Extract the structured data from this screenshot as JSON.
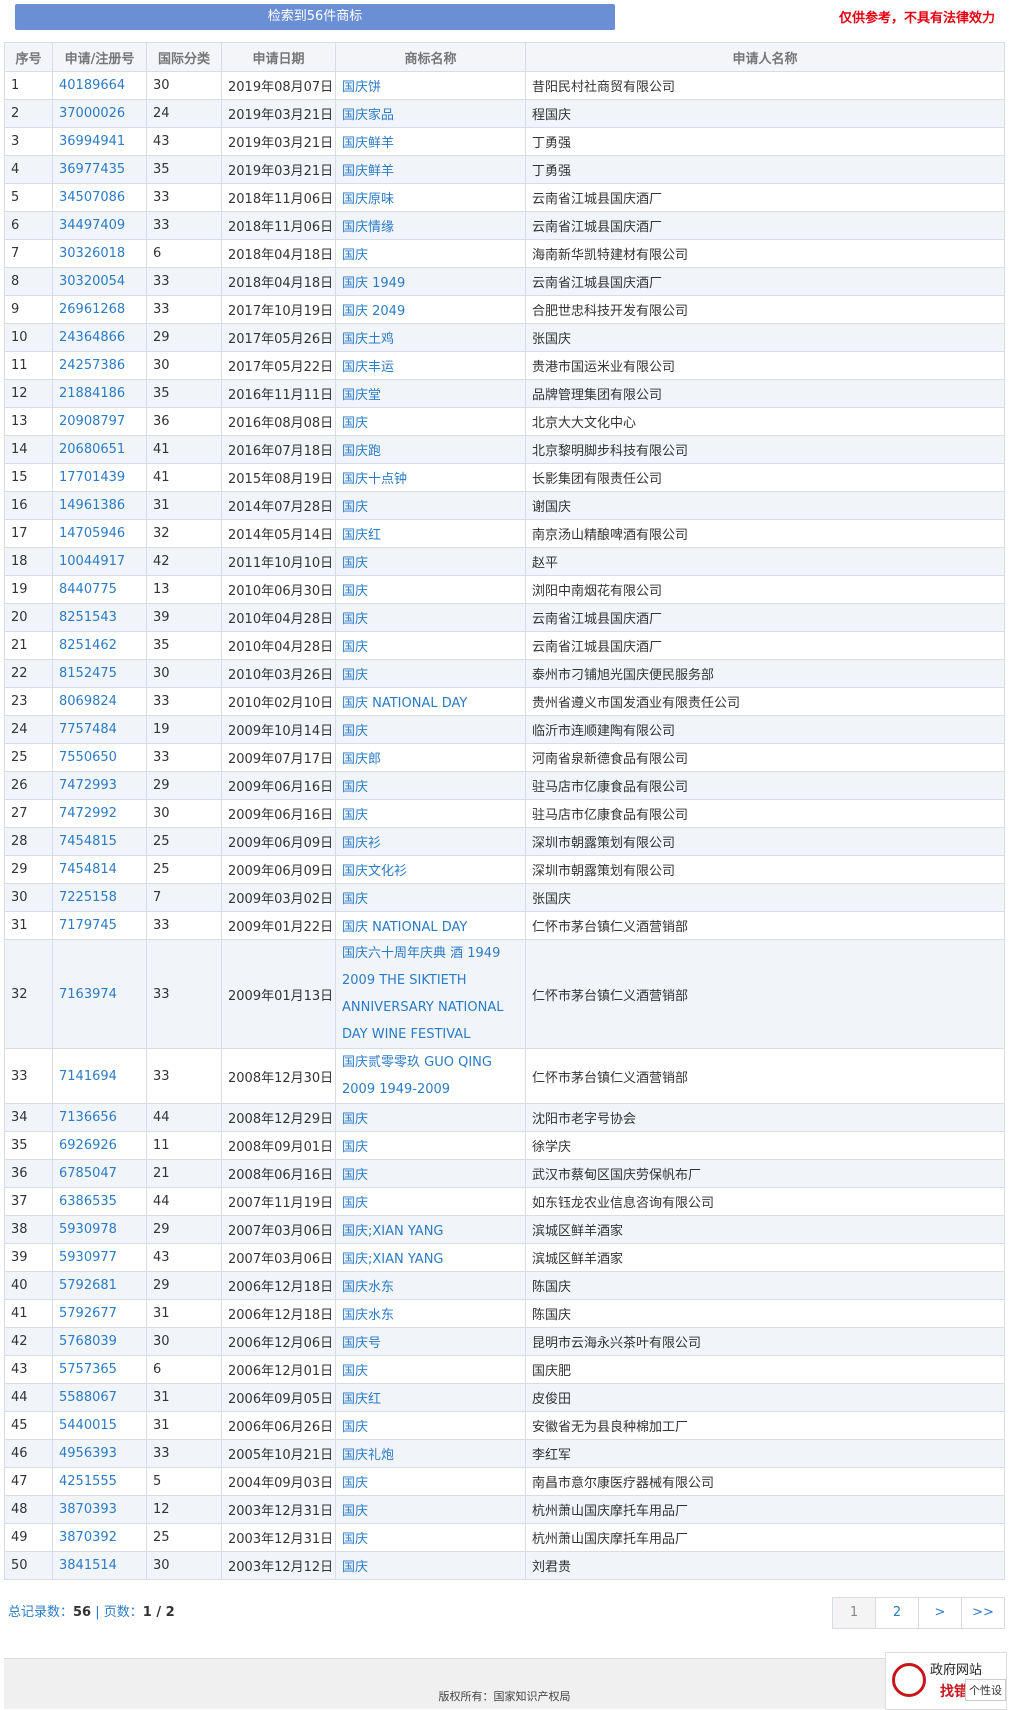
{
  "header": {
    "banner": "检索到56件商标",
    "disclaimer": "仅供参考，不具有法律效力"
  },
  "table": {
    "columns": [
      "序号",
      "申请/注册号",
      "国际分类",
      "申请日期",
      "商标名称",
      "申请人名称"
    ],
    "rows": [
      [
        "1",
        "40189664",
        "30",
        "2019年08月07日",
        "国庆饼",
        "昔阳民村社商贸有限公司"
      ],
      [
        "2",
        "37000026",
        "24",
        "2019年03月21日",
        "国庆家品",
        "程国庆"
      ],
      [
        "3",
        "36994941",
        "43",
        "2019年03月21日",
        "国庆鲜羊",
        "丁勇强"
      ],
      [
        "4",
        "36977435",
        "35",
        "2019年03月21日",
        "国庆鲜羊",
        "丁勇强"
      ],
      [
        "5",
        "34507086",
        "33",
        "2018年11月06日",
        "国庆原味",
        "云南省江城县国庆酒厂"
      ],
      [
        "6",
        "34497409",
        "33",
        "2018年11月06日",
        "国庆情缘",
        "云南省江城县国庆酒厂"
      ],
      [
        "7",
        "30326018",
        "6",
        "2018年04月18日",
        "国庆",
        "海南新华凯特建材有限公司"
      ],
      [
        "8",
        "30320054",
        "33",
        "2018年04月18日",
        "国庆 1949",
        "云南省江城县国庆酒厂"
      ],
      [
        "9",
        "26961268",
        "33",
        "2017年10月19日",
        "国庆 2049",
        "合肥世忠科技开发有限公司"
      ],
      [
        "10",
        "24364866",
        "29",
        "2017年05月26日",
        "国庆土鸡",
        "张国庆"
      ],
      [
        "11",
        "24257386",
        "30",
        "2017年05月22日",
        "国庆丰运",
        "贵港市国运米业有限公司"
      ],
      [
        "12",
        "21884186",
        "35",
        "2016年11月11日",
        "国庆堂",
        "品牌管理集团有限公司"
      ],
      [
        "13",
        "20908797",
        "36",
        "2016年08月08日",
        "国庆",
        "北京大大文化中心"
      ],
      [
        "14",
        "20680651",
        "41",
        "2016年07月18日",
        "国庆跑",
        "北京黎明脚步科技有限公司"
      ],
      [
        "15",
        "17701439",
        "41",
        "2015年08月19日",
        "国庆十点钟",
        "长影集团有限责任公司"
      ],
      [
        "16",
        "14961386",
        "31",
        "2014年07月28日",
        "国庆",
        "谢国庆"
      ],
      [
        "17",
        "14705946",
        "32",
        "2014年05月14日",
        "国庆红",
        "南京汤山精酿啤酒有限公司"
      ],
      [
        "18",
        "10044917",
        "42",
        "2011年10月10日",
        "国庆",
        "赵平"
      ],
      [
        "19",
        "8440775",
        "13",
        "2010年06月30日",
        "国庆",
        "浏阳中南烟花有限公司"
      ],
      [
        "20",
        "8251543",
        "39",
        "2010年04月28日",
        "国庆",
        "云南省江城县国庆酒厂"
      ],
      [
        "21",
        "8251462",
        "35",
        "2010年04月28日",
        "国庆",
        "云南省江城县国庆酒厂"
      ],
      [
        "22",
        "8152475",
        "30",
        "2010年03月26日",
        "国庆",
        "泰州市刁铺旭光国庆便民服务部"
      ],
      [
        "23",
        "8069824",
        "33",
        "2010年02月10日",
        "国庆 NATIONAL DAY",
        "贵州省遵义市国发酒业有限责任公司"
      ],
      [
        "24",
        "7757484",
        "19",
        "2009年10月14日",
        "国庆",
        "临沂市连顺建陶有限公司"
      ],
      [
        "25",
        "7550650",
        "33",
        "2009年07月17日",
        "国庆郎",
        "河南省泉新德食品有限公司"
      ],
      [
        "26",
        "7472993",
        "29",
        "2009年06月16日",
        "国庆",
        "驻马店市亿康食品有限公司"
      ],
      [
        "27",
        "7472992",
        "30",
        "2009年06月16日",
        "国庆",
        "驻马店市亿康食品有限公司"
      ],
      [
        "28",
        "7454815",
        "25",
        "2009年06月09日",
        "国庆衫",
        "深圳市朝露策划有限公司"
      ],
      [
        "29",
        "7454814",
        "25",
        "2009年06月09日",
        "国庆文化衫",
        "深圳市朝露策划有限公司"
      ],
      [
        "30",
        "7225158",
        "7",
        "2009年03月02日",
        "国庆",
        "张国庆"
      ],
      [
        "31",
        "7179745",
        "33",
        "2009年01月22日",
        "国庆 NATIONAL DAY",
        "仁怀市茅台镇仁义酒营销部"
      ],
      [
        "32",
        "7163974",
        "33",
        "2009年01月13日",
        "国庆六十周年庆典 酒 1949 2009 THE SIKTIETH ANNIVERSARY NATIONAL DAY WINE FESTIVAL",
        "仁怀市茅台镇仁义酒营销部"
      ],
      [
        "33",
        "7141694",
        "33",
        "2008年12月30日",
        "国庆贰零零玖 GUO QING 2009 1949-2009",
        "仁怀市茅台镇仁义酒营销部"
      ],
      [
        "34",
        "7136656",
        "44",
        "2008年12月29日",
        "国庆",
        "沈阳市老字号协会"
      ],
      [
        "35",
        "6926926",
        "11",
        "2008年09月01日",
        "国庆",
        "徐学庆"
      ],
      [
        "36",
        "6785047",
        "21",
        "2008年06月16日",
        "国庆",
        "武汉市蔡甸区国庆劳保帆布厂"
      ],
      [
        "37",
        "6386535",
        "44",
        "2007年11月19日",
        "国庆",
        "如东钰龙农业信息咨询有限公司"
      ],
      [
        "38",
        "5930978",
        "29",
        "2007年03月06日",
        "国庆;XIAN YANG",
        "滨城区鲜羊酒家"
      ],
      [
        "39",
        "5930977",
        "43",
        "2007年03月06日",
        "国庆;XIAN YANG",
        "滨城区鲜羊酒家"
      ],
      [
        "40",
        "5792681",
        "29",
        "2006年12月18日",
        "国庆水东",
        "陈国庆"
      ],
      [
        "41",
        "5792677",
        "31",
        "2006年12月18日",
        "国庆水东",
        "陈国庆"
      ],
      [
        "42",
        "5768039",
        "30",
        "2006年12月06日",
        "国庆号",
        "昆明市云海永兴茶叶有限公司"
      ],
      [
        "43",
        "5757365",
        "6",
        "2006年12月01日",
        "国庆",
        "国庆肥"
      ],
      [
        "44",
        "5588067",
        "31",
        "2006年09月05日",
        "国庆红",
        "皮俊田"
      ],
      [
        "45",
        "5440015",
        "31",
        "2006年06月26日",
        "国庆",
        "安徽省无为县良种棉加工厂"
      ],
      [
        "46",
        "4956393",
        "33",
        "2005年10月21日",
        "国庆礼炮",
        "李红军"
      ],
      [
        "47",
        "4251555",
        "5",
        "2004年09月03日",
        "国庆",
        "南昌市意尔康医疗器械有限公司"
      ],
      [
        "48",
        "3870393",
        "12",
        "2003年12月31日",
        "国庆",
        "杭州萧山国庆摩托车用品厂"
      ],
      [
        "49",
        "3870392",
        "25",
        "2003年12月31日",
        "国庆",
        "杭州萧山国庆摩托车用品厂"
      ],
      [
        "50",
        "3841514",
        "30",
        "2003年12月12日",
        "国庆",
        "刘君贵"
      ]
    ]
  },
  "summary": {
    "total_label": "总记录数：",
    "total_value": "56",
    "sep": " | ",
    "pages_label": "页数：",
    "pages_value": "1 / 2"
  },
  "pager": [
    "1",
    "2",
    ">",
    ">>"
  ],
  "footer": {
    "copyright": "版权所有：国家知识产权局"
  },
  "gov_badge": {
    "line1": "政府网站",
    "line2": "找错",
    "line3": "个性设"
  }
}
